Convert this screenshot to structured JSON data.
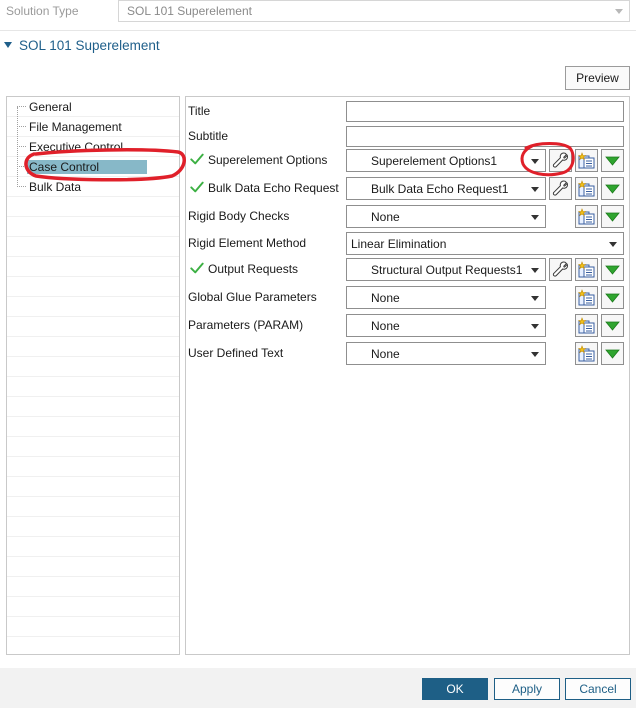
{
  "solution": {
    "label": "Solution Type",
    "value": "SOL 101 Superelement"
  },
  "section": {
    "title": "SOL 101 Superelement"
  },
  "toolbar": {
    "preview_label": "Preview"
  },
  "tree": {
    "items": [
      {
        "label": "General",
        "selected": false
      },
      {
        "label": "File Management",
        "selected": false
      },
      {
        "label": "Executive Control",
        "selected": false
      },
      {
        "label": "Case Control",
        "selected": true
      },
      {
        "label": "Bulk Data",
        "selected": false
      }
    ]
  },
  "form": {
    "rows": [
      {
        "label": "Title",
        "kind": "text",
        "value": ""
      },
      {
        "label": "Subtitle",
        "kind": "text",
        "value": ""
      },
      {
        "label": "Superelement Options",
        "kind": "dropdown",
        "checked": true,
        "value": "Superelement Options1",
        "wrench": true
      },
      {
        "label": "Bulk Data Echo Request",
        "kind": "dropdown",
        "checked": true,
        "value": "Bulk Data Echo Request1",
        "wrench": true
      },
      {
        "label": "Rigid Body Checks",
        "kind": "dropdown",
        "checked": false,
        "value": "None",
        "wrench": false
      },
      {
        "label": "Rigid Element Method",
        "kind": "dropdown-wide",
        "checked": false,
        "value": "Linear Elimination"
      },
      {
        "label": "Output Requests",
        "kind": "dropdown",
        "checked": true,
        "value": "Structural Output Requests1",
        "wrench": true
      },
      {
        "label": "Global Glue Parameters",
        "kind": "dropdown",
        "checked": false,
        "value": "None",
        "wrench": false
      },
      {
        "label": "Parameters (PARAM)",
        "kind": "dropdown",
        "checked": false,
        "value": "None",
        "wrench": false
      },
      {
        "label": "User Defined Text",
        "kind": "dropdown",
        "checked": false,
        "value": "None",
        "wrench": false
      }
    ]
  },
  "dialog": {
    "ok_label": "OK",
    "apply_label": "Apply",
    "cancel_label": "Cancel"
  },
  "colors": {
    "accent": "#1e5f86",
    "selection": "#87b8c8",
    "check": "#3cb043",
    "annotation": "#e0202a"
  },
  "icons": [
    "chevron-down-icon",
    "check-icon",
    "wrench-icon",
    "create-icon",
    "green-arrow-down-icon"
  ]
}
